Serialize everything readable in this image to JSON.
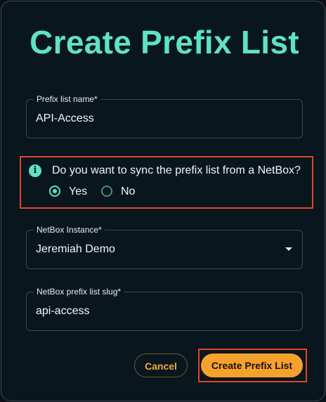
{
  "dialog": {
    "title": "Create Prefix List"
  },
  "fields": {
    "prefix_list_name": {
      "label": "Prefix list name",
      "required_mark": "*",
      "value": "API-Access"
    },
    "netbox_instance": {
      "label": "NetBox Instance",
      "required_mark": "*",
      "value": "Jeremiah Demo"
    },
    "netbox_slug": {
      "label": "NetBox prefix list slug",
      "required_mark": "*",
      "value": "api-access"
    }
  },
  "sync": {
    "icon": "info-icon",
    "icon_glyph": "i",
    "question": "Do you want to sync the prefix list from a NetBox?",
    "options": [
      {
        "label": "Yes",
        "selected": true
      },
      {
        "label": "No",
        "selected": false
      }
    ]
  },
  "actions": {
    "cancel_label": "Cancel",
    "create_label": "Create Prefix List"
  },
  "colors": {
    "accent": "#5ee3c1",
    "primary_button": "#f5a12e",
    "highlight": "#e0452a",
    "background": "#0a161d"
  }
}
